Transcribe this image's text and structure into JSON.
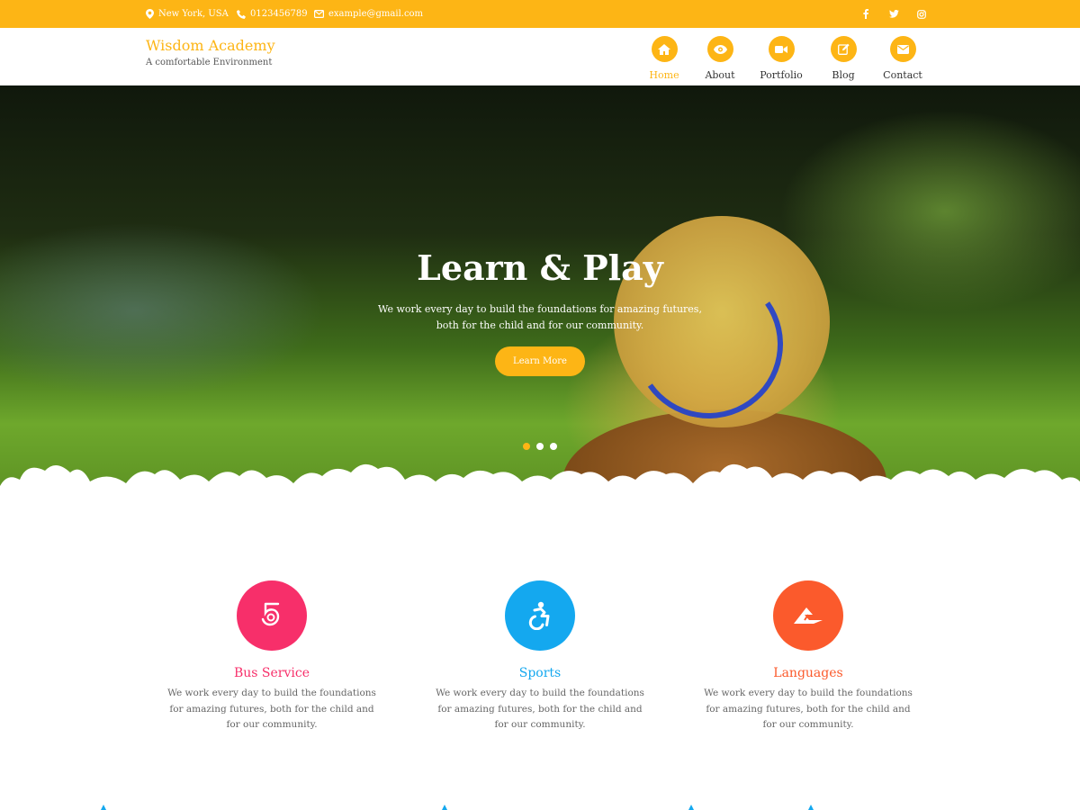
{
  "topbar": {
    "location": "New York, USA",
    "phone": "0123456789",
    "email": "example@gmail.com",
    "social": [
      "facebook-icon",
      "twitter-icon",
      "instagram-icon"
    ]
  },
  "brand": {
    "title": "Wisdom Academy",
    "tagline": "A comfortable Environment"
  },
  "nav": {
    "items": [
      {
        "label": "Home",
        "icon": "home-icon",
        "active": true
      },
      {
        "label": "About",
        "icon": "eye-icon",
        "active": false
      },
      {
        "label": "Portfolio",
        "icon": "video-camera-icon",
        "active": false
      },
      {
        "label": "Blog",
        "icon": "edit-icon",
        "active": false
      },
      {
        "label": "Contact",
        "icon": "envelope-icon",
        "active": false
      }
    ]
  },
  "hero": {
    "title": "Learn & Play",
    "text": "We work every day to build the foundations for amazing futures, both for the child and for our community.",
    "button": "Learn More",
    "slides": 3,
    "active_slide": 1
  },
  "features": [
    {
      "title": "Bus Service",
      "icon": "five-hundred-px-icon",
      "color": "#f72f6a",
      "text": "We work every day to build the foundations for amazing futures, both for the child and for our community."
    },
    {
      "title": "Sports",
      "icon": "accessible-icon",
      "color": "#14a8ef",
      "text": "We work every day to build the foundations for amazing futures, both for the child and for our community."
    },
    {
      "title": "Languages",
      "icon": "affiliate-icon",
      "color": "#fb5a2c",
      "text": "We work every day to build the foundations for amazing futures, both for the child and for our community."
    }
  ],
  "colors": {
    "accent": "#fdb515",
    "text": "#333333",
    "muted": "#666666"
  }
}
